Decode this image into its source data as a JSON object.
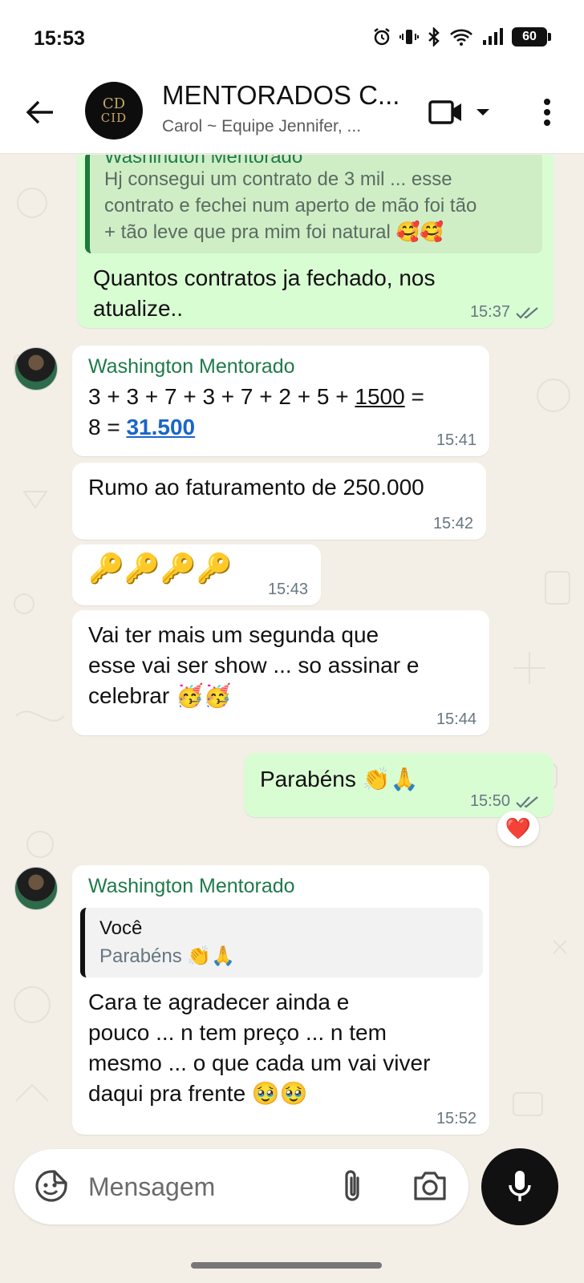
{
  "status_bar": {
    "time": "15:53",
    "battery": "60"
  },
  "header": {
    "title": "MENTORADOS C...",
    "subtitle": "Carol ~ Equipe Jennifer, ...",
    "avatar_text": "CID",
    "avatar_mark": "CD"
  },
  "messages": {
    "m1": {
      "quote_author": "Washington Mentorado",
      "quote_text_1": "Hj consegui um contrato de 3 mil ... esse",
      "quote_text_2": "contrato e fechei num aperto de mão foi tão",
      "quote_text_3": "+ tão leve que pra mim foi natural 🥰🥰",
      "text_1": "Quantos contratos ja fechado, nos",
      "text_2": "atualize..",
      "time": "15:37"
    },
    "m2": {
      "sender": "Washington Mentorado",
      "text_1a": "3 + 3 + 7 + 3  + 7 + 2 + 5 + ",
      "text_1b": "1500",
      "text_1c": " =",
      "text_2a": "8 = ",
      "text_2b": "31.500",
      "time": "15:41"
    },
    "m3": {
      "text": "Rumo ao faturamento de 250.000",
      "time": "15:42"
    },
    "m4": {
      "text": "🔑🔑🔑🔑",
      "time": "15:43"
    },
    "m5": {
      "text_1": "Vai ter mais um segunda que",
      "text_2": "esse vai ser show ... so assinar e",
      "text_3": "celebrar 🥳🥳",
      "time": "15:44"
    },
    "m6": {
      "text": "Parabéns 👏🙏",
      "time": "15:50",
      "reaction": "❤️"
    },
    "m7": {
      "sender": "Washington Mentorado",
      "quote_author": "Você",
      "quote_text": "Parabéns 👏🙏",
      "text_1": "Cara te agradecer ainda e",
      "text_2": "pouco ... n tem preço ... n tem",
      "text_3": "mesmo ... o que cada um vai viver",
      "text_4": "daqui pra frente 🥹🥹",
      "time": "15:52"
    }
  },
  "composer": {
    "placeholder": "Mensagem"
  },
  "colors": {
    "outgoing_bubble": "#d9fdd3",
    "incoming_bubble": "#ffffff",
    "sender_name": "#1f7a4a",
    "chat_background": "#f3efe7",
    "mic_button": "#111111"
  }
}
